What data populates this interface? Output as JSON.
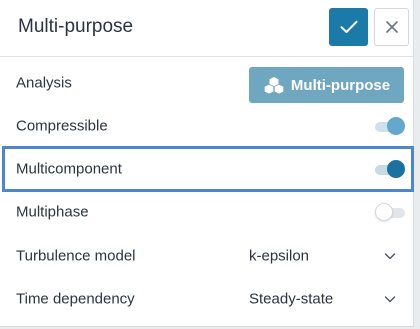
{
  "header": {
    "title": "Multi-purpose",
    "confirm_icon": "check-icon",
    "close_icon": "close-icon"
  },
  "rows": {
    "analysis": {
      "label": "Analysis",
      "button_label": "Multi-purpose",
      "button_icon": "cubes-icon"
    },
    "compressible": {
      "label": "Compressible",
      "enabled": true
    },
    "multicomponent": {
      "label": "Multicomponent",
      "enabled": true
    },
    "multiphase": {
      "label": "Multiphase",
      "enabled": false
    },
    "turbulence": {
      "label": "Turbulence model",
      "value": "k-epsilon"
    },
    "time": {
      "label": "Time dependency",
      "value": "Steady-state"
    }
  },
  "colors": {
    "primary": "#1b7aa8",
    "analysis_button": "#6fa7c0",
    "highlight_border": "#4d86cc"
  }
}
